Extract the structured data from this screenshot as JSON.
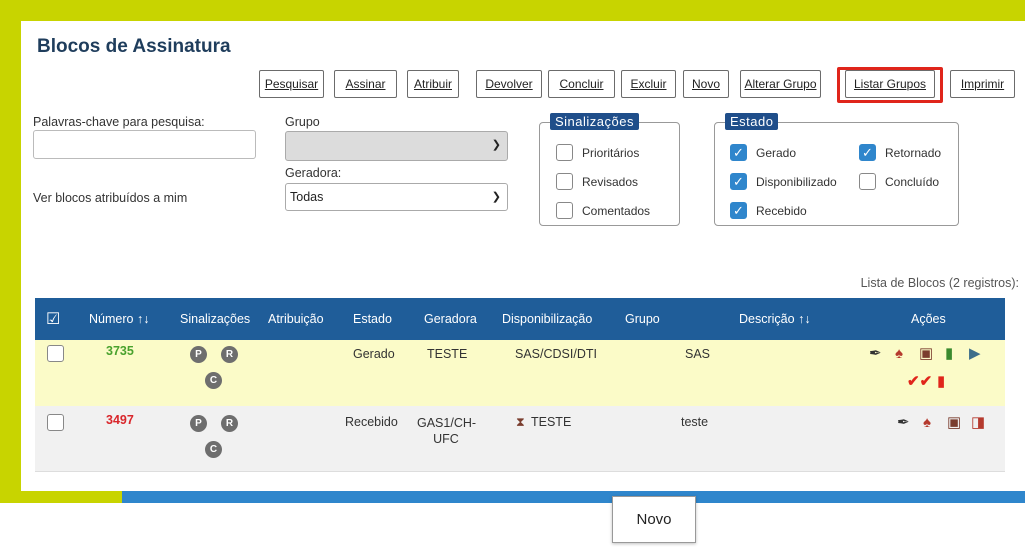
{
  "page": {
    "title": "Blocos de Assinatura"
  },
  "toolbar": {
    "buttons": [
      "Pesquisar",
      "Assinar",
      "Atribuir",
      "Devolver",
      "Concluir",
      "Excluir",
      "Novo",
      "Alterar Grupo",
      "Listar Grupos",
      "Imprimir"
    ],
    "highlighted": "Listar Grupos",
    "highlight_color": "#e0251b"
  },
  "filters": {
    "keywords_label": "Palavras-chave para pesquisa:",
    "keywords_value": "",
    "group_label": "Grupo",
    "group_value": "",
    "generator_label": "Geradora:",
    "generator_value": "Todas",
    "assigned_label": "Ver blocos atribuídos a mim"
  },
  "signals": {
    "legend": "Sinalizações",
    "options": [
      {
        "label": "Prioritários",
        "checked": false
      },
      {
        "label": "Revisados",
        "checked": false
      },
      {
        "label": "Comentados",
        "checked": false
      }
    ]
  },
  "state": {
    "legend": "Estado",
    "options": [
      {
        "label": "Gerado",
        "checked": true
      },
      {
        "label": "Retornado",
        "checked": true
      },
      {
        "label": "Disponibilizado",
        "checked": true
      },
      {
        "label": "Concluído",
        "checked": false
      },
      {
        "label": "Recebido",
        "checked": true
      }
    ]
  },
  "list": {
    "count_text": "Lista de Blocos (2 registros):",
    "columns": [
      "Número",
      "Sinalizações",
      "Atribuição",
      "Estado",
      "Geradora",
      "Disponibilização",
      "Grupo",
      "Descrição",
      "Ações"
    ],
    "rows": [
      {
        "number": "3735",
        "number_color": "#4aa22e",
        "badges": [
          "P",
          "R",
          "C"
        ],
        "attribution": "",
        "state": "Gerado",
        "generator": "TESTE",
        "availability": "SAS/CDSI/DTI",
        "group": "",
        "description": "SAS",
        "bg": "#fbfbc8",
        "actions": [
          "edit-icon",
          "user-icon",
          "search-doc-icon",
          "document-green-icon",
          "arrow-doc-icon",
          "sign-check-icon",
          "trash-icon"
        ]
      },
      {
        "number": "3497",
        "number_color": "#d9262b",
        "badges": [
          "P",
          "R",
          "C"
        ],
        "attribution": "",
        "state": "Recebido",
        "generator": "GAS1/CH-UFC",
        "availability": "TESTE",
        "group": "",
        "description": "teste",
        "bg": "#f1f1f1",
        "actions": [
          "edit-icon",
          "user-icon",
          "search-doc-icon",
          "return-icon"
        ]
      }
    ]
  },
  "tooltip": {
    "text": "Novo"
  },
  "colors": {
    "accent_green": "#c8d400",
    "accent_blue": "#2f86cc",
    "header_blue": "#1f5d99"
  }
}
